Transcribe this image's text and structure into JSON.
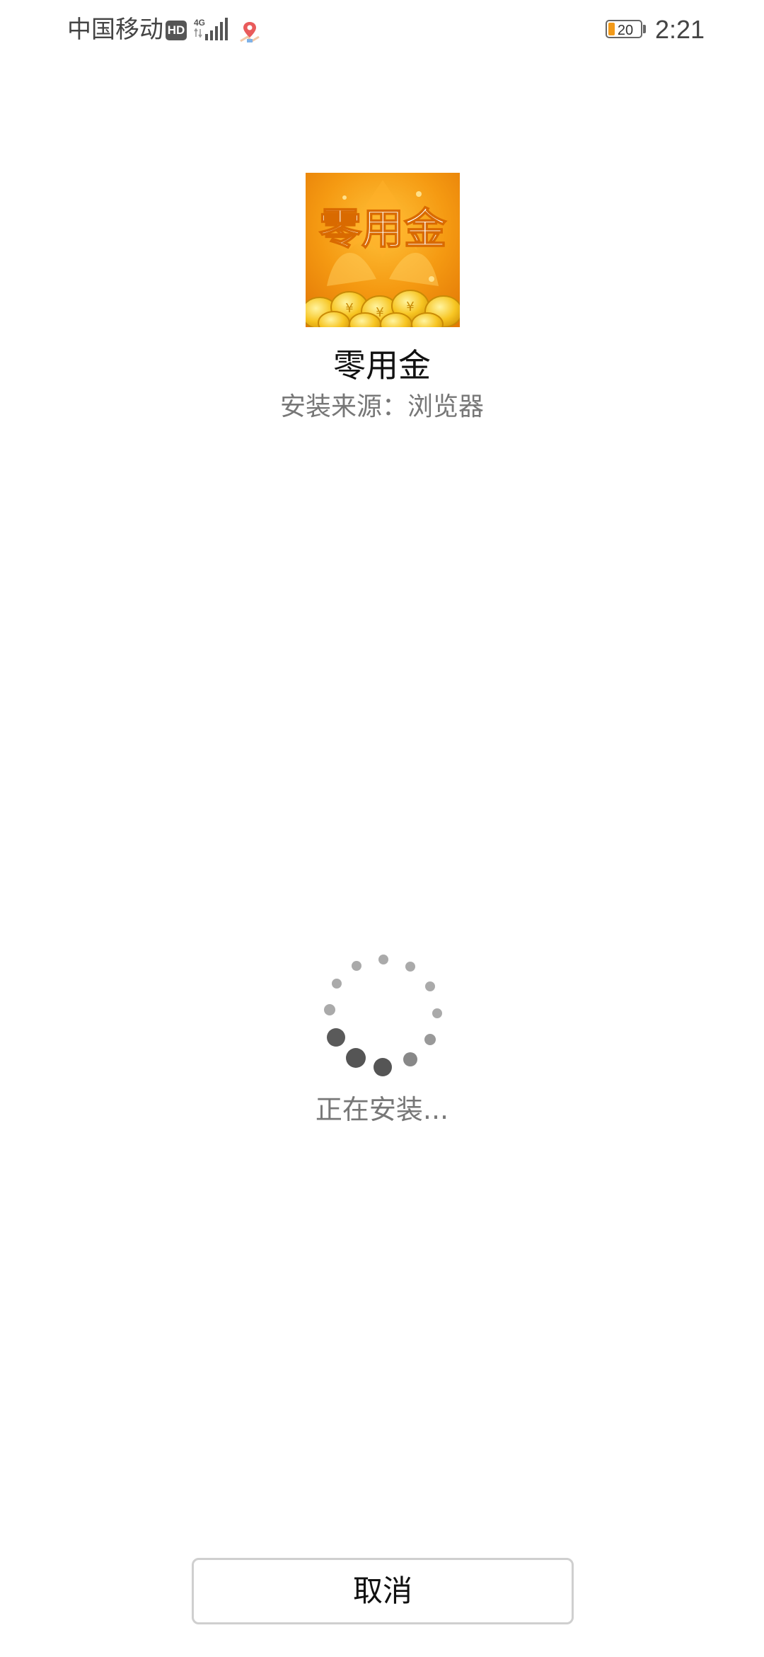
{
  "status_bar": {
    "carrier": "中国移动",
    "hd_badge": "HD",
    "network_type": "4G",
    "battery_level": "20",
    "time": "2:21",
    "icons": [
      "hd-icon",
      "signal-4g-icon",
      "location-icon",
      "battery-icon"
    ]
  },
  "app": {
    "icon_lettering": "零用金",
    "name": "零用金",
    "install_source": "安装来源：浏览器"
  },
  "progress": {
    "status_text": "正在安装..."
  },
  "actions": {
    "cancel_label": "取消"
  },
  "colors": {
    "accent_orange": "#f29a1a",
    "spinner_dark": "#555555",
    "spinner_light": "#aaaaaa"
  }
}
